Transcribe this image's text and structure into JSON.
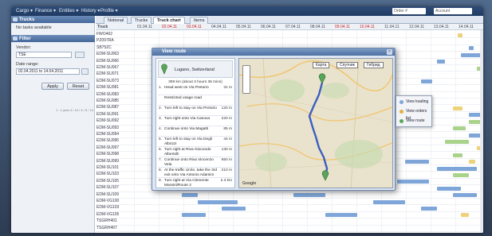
{
  "menubar": {
    "items": [
      "Cargo ▾",
      "Finance ▾",
      "Entities ▾",
      "History ▾",
      "Profile ▾"
    ],
    "search_value": "Order #",
    "account_value": "Account",
    "brand": "CargoMate"
  },
  "sidebar": {
    "trucks_title": "Trucks",
    "trucks_empty": "No tasks available",
    "filter_title": "Filter",
    "vendor_label": "Vendor:",
    "vendor_value": "TSE",
    "date_label": "Date range:",
    "date_value": "02.04.2011 to 14.04.2011",
    "apply": "Apply",
    "reset": "Reset",
    "paging": "1 - 1 year 4 / 14 / 4 / 5 / 14"
  },
  "tabs": [
    "Notional",
    "Trucks",
    "Truck chart",
    "Items"
  ],
  "timeline": {
    "corner_label": "Truck",
    "dates": [
      "01.04.11",
      "02.04.11",
      "03.04.11",
      "04.04.11",
      "05.04.11",
      "06.04.11",
      "07.04.11",
      "08.04.11",
      "09.04.11",
      "10.04.11",
      "11.04.11",
      "12.04.11",
      "13.04.11",
      "14.04.11"
    ],
    "weekend_color": "#cc2222",
    "rows": [
      "FWO462",
      "PZ097RA",
      "SB75ZC",
      "EDM-SU063",
      "EDM-SU066",
      "EDM-SU067",
      "EDM-SU071",
      "EDM-SU073",
      "EDM-SU081",
      "EDM-SU083",
      "EDM-SU085",
      "EDM-SU087",
      "EDM-SU091",
      "EDM-SU092",
      "EDM-SU093",
      "EDM-SU094",
      "EDM-SU095",
      "EDM-SU097",
      "EDM-SU098",
      "EDM-SU099",
      "EDM-SU101",
      "EDM-SU103",
      "EDM-SU105",
      "EDM-SU107",
      "EDM-SU109",
      "EDM-VG100",
      "EDM-VG103",
      "EDM-VG105",
      "TSGRH401",
      "TSGRH407"
    ],
    "colors": {
      "blue": "#7fa6d8",
      "green": "#a9d38a",
      "yellow": "#eed27a"
    }
  },
  "dialog": {
    "title": "View route",
    "place": "Lugano, Switzerland",
    "summary": "399 km (about 3 hours 36 mins)",
    "steps": [
      {
        "n": "1.",
        "text": "Head west on Via Pretorio",
        "dist": "31 m"
      },
      {
        "n": "",
        "text": "Restricted usage road",
        "dist": ""
      },
      {
        "n": "2.",
        "text": "Turn left to stay on Via Pretorio",
        "dist": "120 m"
      },
      {
        "n": "3.",
        "text": "Turn right onto Via Canova",
        "dist": "220 m"
      },
      {
        "n": "4.",
        "text": "Continue onto Via Magatti",
        "dist": "85 m"
      },
      {
        "n": "5.",
        "text": "Turn left to stay on Via Degli Albrizzi",
        "dist": "44 m"
      },
      {
        "n": "6.",
        "text": "Turn right at Riva Giocondo Albertolli",
        "dist": "130 m"
      },
      {
        "n": "7.",
        "text": "Continue onto Riva Vincenzo Vela",
        "dist": "650 m"
      },
      {
        "n": "8.",
        "text": "At the traffic circle, take the 3rd exit onto Via Antonio Adamini",
        "dist": "210 m"
      },
      {
        "n": "9.",
        "text": "Turn right at Via Clemente Maraini/Route 2",
        "dist": "2.3 km"
      }
    ],
    "map_buttons": [
      "Карта",
      "Спутник",
      "Гибрид"
    ],
    "map_copyright": "Google"
  },
  "context_menu": {
    "items": [
      "View loading",
      "View orders list",
      "View route"
    ],
    "icon_colors": [
      "#7fa6d8",
      "#e0b040",
      "#5aa55a"
    ]
  }
}
